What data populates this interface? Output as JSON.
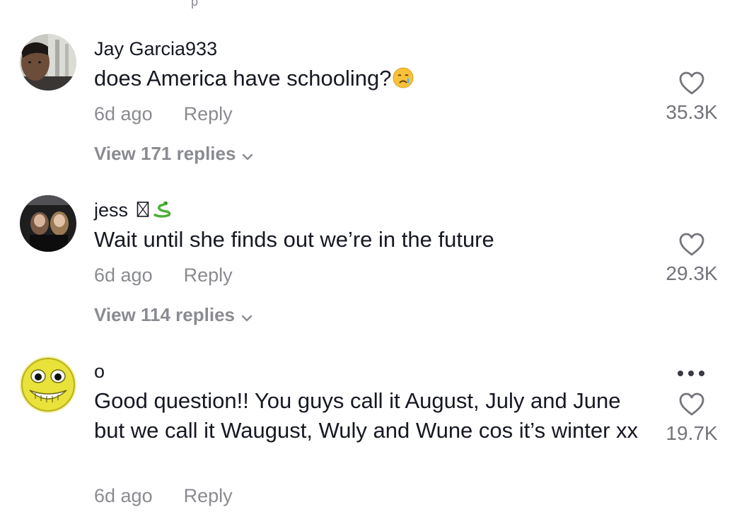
{
  "cut_off_text": "p",
  "comments": [
    {
      "username": "Jay Garcia933",
      "username_emoji": "",
      "text": "does America have schooling?",
      "text_emoji": "crying-face-emoji",
      "time": "6d ago",
      "reply_label": "Reply",
      "likes": "35.3K",
      "view_replies": "View 171 replies",
      "has_more_menu": false
    },
    {
      "username": "jess",
      "username_emoji": "missing-glyph snake-emoji",
      "text": "Wait until she finds out we’re in the future",
      "text_emoji": "",
      "time": "6d ago",
      "reply_label": "Reply",
      "likes": "29.3K",
      "view_replies": "View 114 replies",
      "has_more_menu": false
    },
    {
      "username": "o",
      "username_emoji": "",
      "text": "Good question!! You guys call it August, July and June but we call it Waugust, Wuly and Wune cos it’s winter xx",
      "text_emoji": "",
      "time": "6d ago",
      "reply_label": "Reply",
      "likes": "19.7K",
      "view_replies": "",
      "has_more_menu": true
    }
  ],
  "colors": {
    "primary_text": "#161823",
    "secondary_text": "#8a8b91",
    "like_count": "#73747b",
    "background": "#ffffff"
  }
}
